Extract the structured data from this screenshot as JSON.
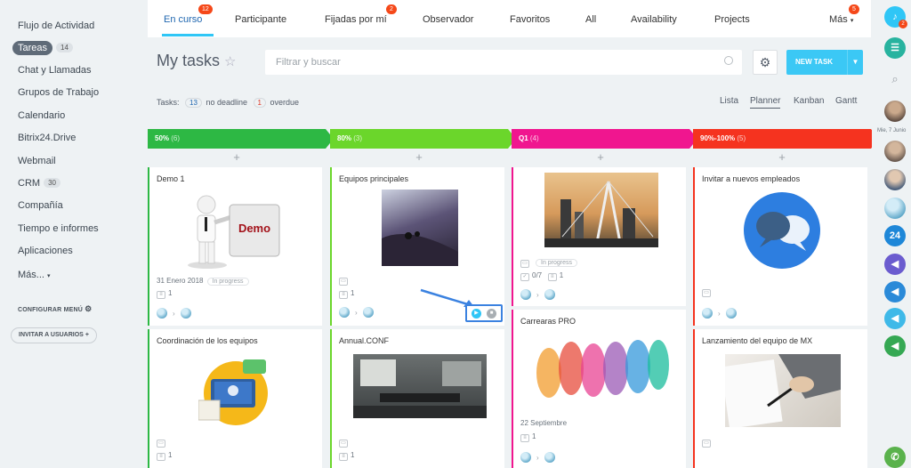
{
  "sidebar": {
    "items": [
      {
        "label": "Flujo de Actividad",
        "count": ""
      },
      {
        "label": "Tareas",
        "count": "14"
      },
      {
        "label": "Chat y Llamadas",
        "count": ""
      },
      {
        "label": "Grupos de Trabajo",
        "count": ""
      },
      {
        "label": "Calendario",
        "count": ""
      },
      {
        "label": "Bitrix24.Drive",
        "count": ""
      },
      {
        "label": "Webmail",
        "count": ""
      },
      {
        "label": "CRM",
        "count": "30"
      },
      {
        "label": "Compañía",
        "count": ""
      },
      {
        "label": "Tiempo e informes",
        "count": ""
      },
      {
        "label": "Aplicaciones",
        "count": ""
      },
      {
        "label": "Más...",
        "count": ""
      }
    ],
    "config_label": "CONFIGURAR MENÚ",
    "invite_label": "INVITAR A USUARIOS"
  },
  "tabs": [
    {
      "label": "En curso",
      "badge": "12"
    },
    {
      "label": "Participante",
      "badge": ""
    },
    {
      "label": "Fijadas por mí",
      "badge": "2"
    },
    {
      "label": "Observador",
      "badge": ""
    },
    {
      "label": "Favoritos",
      "badge": ""
    },
    {
      "label": "All",
      "badge": ""
    },
    {
      "label": "Availability",
      "badge": ""
    },
    {
      "label": "Projects",
      "badge": ""
    },
    {
      "label": "Más",
      "badge": "5"
    }
  ],
  "header": {
    "title": "My tasks",
    "search_placeholder": "Filtrar y buscar",
    "new_task_label": "NEW TASK"
  },
  "filters": {
    "tasks_label": "Tasks:",
    "no_deadline_count": "13",
    "no_deadline_label": "no deadline",
    "overdue_count": "1",
    "overdue_label": "overdue"
  },
  "views": [
    "Lista",
    "Planner",
    "Kanban",
    "Gantt"
  ],
  "columns": [
    {
      "title": "50%",
      "count": "(6)",
      "color": "#2db844"
    },
    {
      "title": "80%",
      "count": "(3)",
      "color": "#6bd62b"
    },
    {
      "title": "Q1",
      "count": "(4)",
      "color": "#f0168f"
    },
    {
      "title": "90%-100%",
      "count": "(5)",
      "color": "#f5331f"
    }
  ],
  "cards": {
    "demo": {
      "title": "Demo 1",
      "image_text": "Demo",
      "date": "31 Enero 2018",
      "status": "In progress",
      "checks": "1"
    },
    "equipos": {
      "title": "Equipos principales",
      "checks": "1"
    },
    "q1card": {
      "status": "In progress",
      "subtasks": "0/7",
      "checks": "1"
    },
    "invitar": {
      "title": "Invitar a nuevos empleados"
    },
    "coord": {
      "title": "Coordinación de los equipos",
      "checks": "1"
    },
    "annual": {
      "title": "Annual.CONF",
      "checks": "1"
    },
    "carreras": {
      "title": "Carrearas PRO",
      "date": "22 Septiembre",
      "checks": "1"
    },
    "lanz": {
      "title": "Lanzamiento del equipo de MX"
    }
  },
  "rightbar": {
    "notif_badge": "2",
    "date_label": "Mie, 7 Junio",
    "b24_label": "24"
  },
  "colors": {
    "accent": "#3bc8f5",
    "active_tab": "#2067b0"
  }
}
